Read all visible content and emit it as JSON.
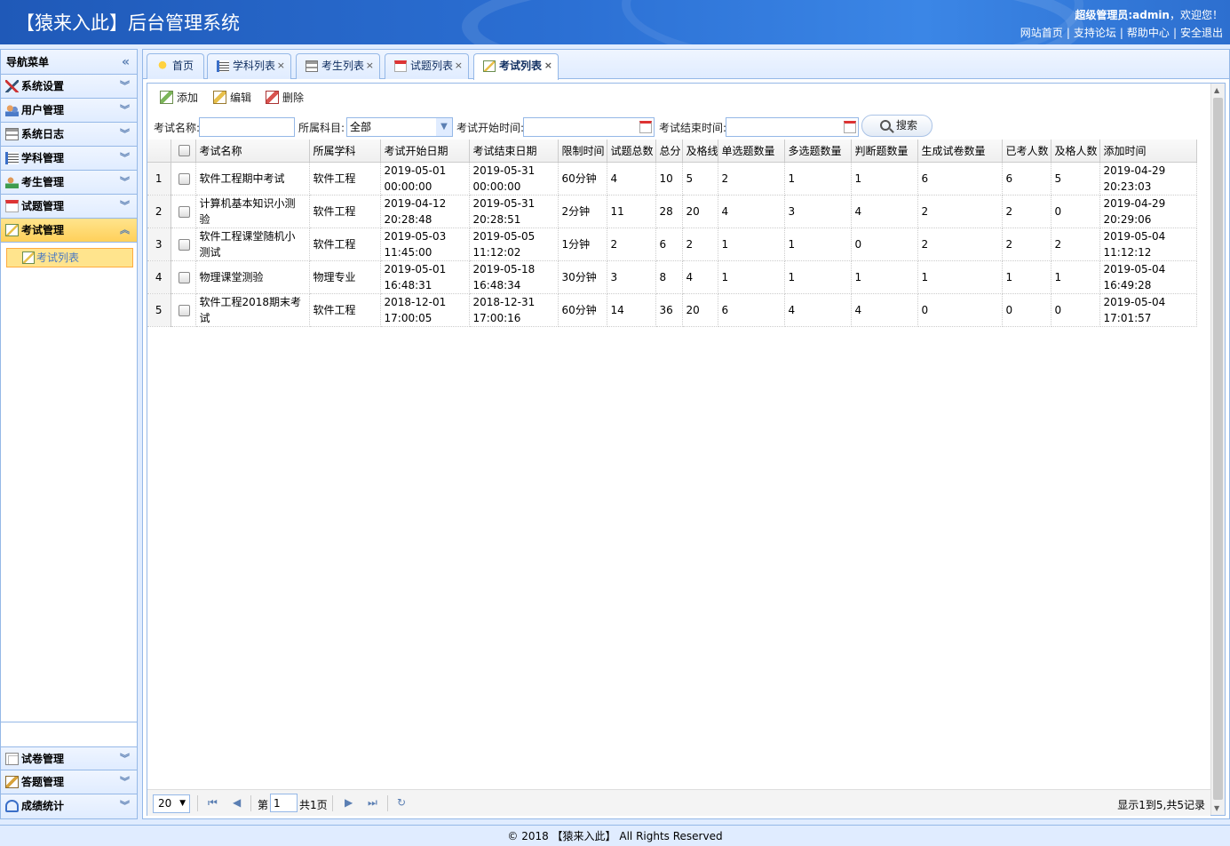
{
  "header": {
    "title": "【猿来入此】后台管理系统",
    "welcome_user": "超级管理员:admin",
    "welcome_suffix": "，欢迎您！",
    "links": [
      "网站首页",
      "支持论坛",
      "帮助中心",
      "安全退出"
    ]
  },
  "sidebar": {
    "title": "导航菜单",
    "items": [
      {
        "label": "系统设置",
        "icon": "tools-icon"
      },
      {
        "label": "用户管理",
        "icon": "users-icon"
      },
      {
        "label": "系统日志",
        "icon": "log-icon"
      },
      {
        "label": "学科管理",
        "icon": "subject-icon"
      },
      {
        "label": "考生管理",
        "icon": "student-icon"
      },
      {
        "label": "试题管理",
        "icon": "calendar-icon"
      },
      {
        "label": "考试管理",
        "icon": "exam-icon"
      }
    ],
    "sub_item": "考试列表",
    "bottom_items": [
      {
        "label": "试卷管理",
        "icon": "paper-icon"
      },
      {
        "label": "答题管理",
        "icon": "answer-icon"
      },
      {
        "label": "成绩统计",
        "icon": "stats-icon"
      }
    ]
  },
  "tabs": [
    {
      "label": "首页",
      "closable": false
    },
    {
      "label": "学科列表",
      "closable": true
    },
    {
      "label": "考生列表",
      "closable": true
    },
    {
      "label": "试题列表",
      "closable": true
    },
    {
      "label": "考试列表",
      "closable": true,
      "active": true
    }
  ],
  "toolbar": {
    "add": "添加",
    "edit": "编辑",
    "delete": "删除"
  },
  "search": {
    "name_label": "考试名称:",
    "name_value": "",
    "subject_label": "所属科目:",
    "subject_value": "全部",
    "start_label": "考试开始时间:",
    "start_value": "",
    "end_label": "考试结束时间:",
    "end_value": "",
    "button": "搜索"
  },
  "grid": {
    "columns": [
      "考试名称",
      "所属学科",
      "考试开始日期",
      "考试结束日期",
      "限制时间",
      "试题总数",
      "总分",
      "及格线",
      "单选题数量",
      "多选题数量",
      "判断题数量",
      "生成试卷数量",
      "已考人数",
      "及格人数",
      "添加时间"
    ],
    "rows": [
      {
        "n": "1",
        "name": "软件工程期中考试",
        "subject": "软件工程",
        "start": "2019-05-01 00:00:00",
        "end": "2019-05-31 00:00:00",
        "limit": "60分钟",
        "total_q": "4",
        "score": "10",
        "pass": "5",
        "single": "2",
        "multi": "1",
        "judge": "1",
        "papers": "6",
        "taken": "6",
        "passed": "5",
        "added": "2019-04-29 20:23:03"
      },
      {
        "n": "2",
        "name": "计算机基本知识小测验",
        "subject": "软件工程",
        "start": "2019-04-12 20:28:48",
        "end": "2019-05-31 20:28:51",
        "limit": "2分钟",
        "total_q": "11",
        "score": "28",
        "pass": "20",
        "single": "4",
        "multi": "3",
        "judge": "4",
        "papers": "2",
        "taken": "2",
        "passed": "0",
        "added": "2019-04-29 20:29:06"
      },
      {
        "n": "3",
        "name": "软件工程课堂随机小测试",
        "subject": "软件工程",
        "start": "2019-05-03 11:45:00",
        "end": "2019-05-05 11:12:02",
        "limit": "1分钟",
        "total_q": "2",
        "score": "6",
        "pass": "2",
        "single": "1",
        "multi": "1",
        "judge": "0",
        "papers": "2",
        "taken": "2",
        "passed": "2",
        "added": "2019-05-04 11:12:12"
      },
      {
        "n": "4",
        "name": "物理课堂测验",
        "subject": "物理专业",
        "start": "2019-05-01 16:48:31",
        "end": "2019-05-18 16:48:34",
        "limit": "30分钟",
        "total_q": "3",
        "score": "8",
        "pass": "4",
        "single": "1",
        "multi": "1",
        "judge": "1",
        "papers": "1",
        "taken": "1",
        "passed": "1",
        "added": "2019-05-04 16:49:28"
      },
      {
        "n": "5",
        "name": "软件工程2018期末考试",
        "subject": "软件工程",
        "start": "2018-12-01 17:00:05",
        "end": "2018-12-31 17:00:16",
        "limit": "60分钟",
        "total_q": "14",
        "score": "36",
        "pass": "20",
        "single": "6",
        "multi": "4",
        "judge": "4",
        "papers": "0",
        "taken": "0",
        "passed": "0",
        "added": "2019-05-04 17:01:57"
      }
    ]
  },
  "pager": {
    "page_size": "20",
    "page_prefix": "第",
    "page_value": "1",
    "page_total": "共1页",
    "info": "显示1到5,共5记录"
  },
  "footer": "© 2018 【猿来入此】 All Rights Reserved"
}
